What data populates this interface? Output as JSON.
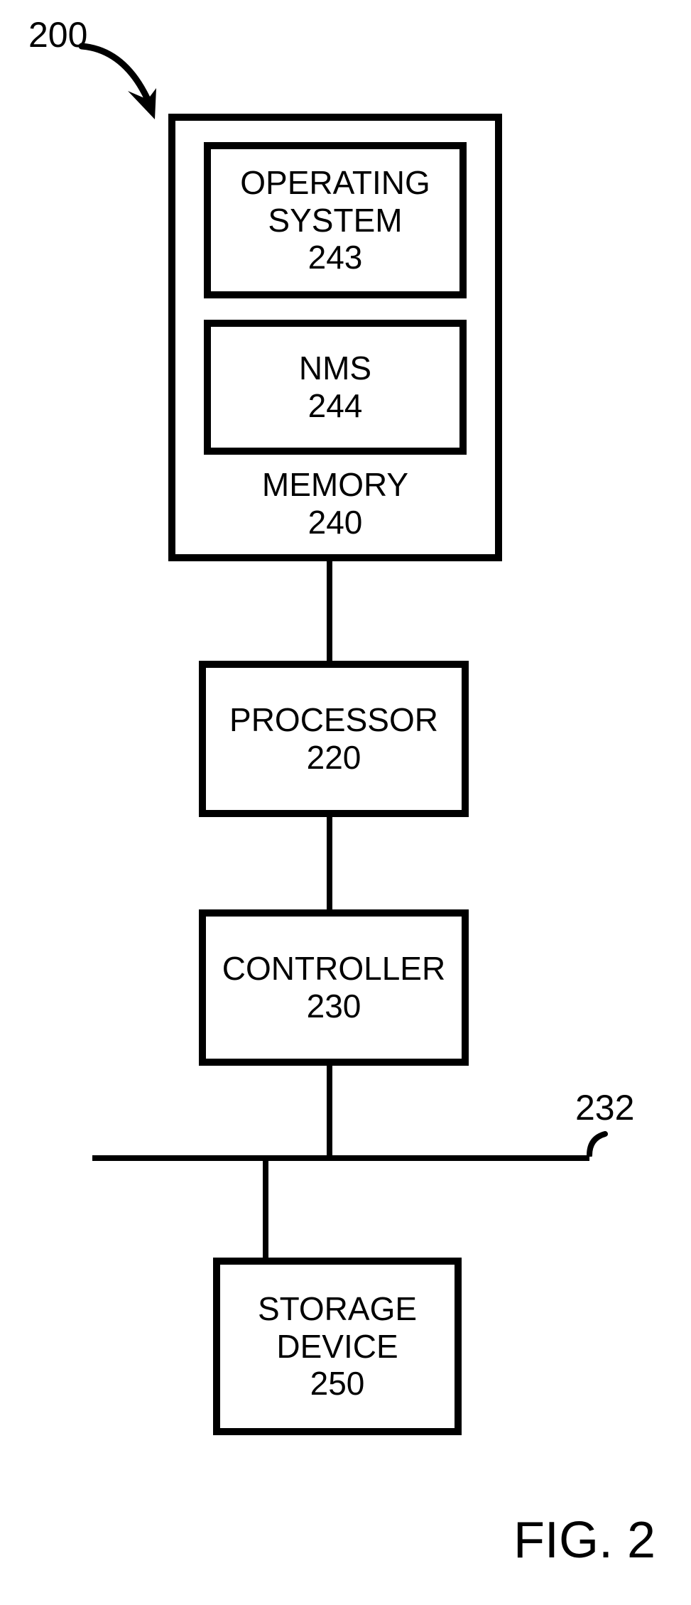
{
  "ref": {
    "overall": "200",
    "bus": "232"
  },
  "blocks": {
    "os": {
      "label1": "OPERATING",
      "label2": "SYSTEM",
      "num": "243"
    },
    "nms": {
      "label": "NMS",
      "num": "244"
    },
    "memory": {
      "label": "MEMORY",
      "num": "240"
    },
    "processor": {
      "label": "PROCESSOR",
      "num": "220"
    },
    "controller": {
      "label": "CONTROLLER",
      "num": "230"
    },
    "storage": {
      "label1": "STORAGE",
      "label2": "DEVICE",
      "num": "250"
    }
  },
  "caption": "FIG. 2"
}
